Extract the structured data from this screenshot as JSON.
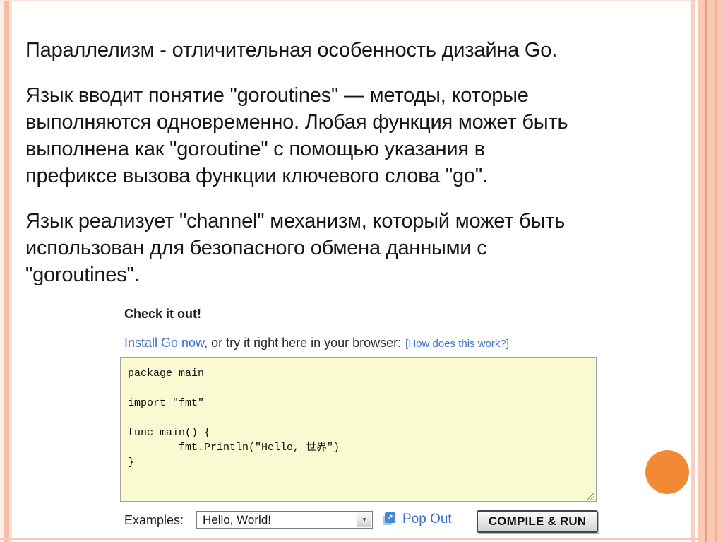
{
  "slide": {
    "paragraph1": "Параллелизм - отличительная особенность дизайна Go.",
    "paragraph2": "Язык вводит понятие \"goroutines\" — методы, которые\nвыполняются одновременно. Любая функция может быть\nвыполнена как \"goroutine\" с помощью указания в\nпрефиксе вызова функции ключевого слова \"go\".",
    "paragraph3": "Язык реализует \"channel\" механизм, который может быть\nиспользован для безопасного обмена данными с\n\"goroutines\"."
  },
  "widget": {
    "heading": "Check it out!",
    "install_line": {
      "link": "Install Go now",
      "rest": ", or try it right here in your browser:",
      "how": "[How does this work?]"
    },
    "code": "package main\n\nimport \"fmt\"\n\nfunc main() {\n        fmt.Println(\"Hello, 世界\")\n}",
    "controls": {
      "examples_label": "Examples:",
      "examples_value": "Hello, World!",
      "popout_label": "Pop Out",
      "compile_label": "COMPILE & RUN"
    }
  },
  "icons": {
    "dropdown_arrow": "▼",
    "popout_arrow": "↗"
  },
  "colors": {
    "accent_orange": "#F18A33",
    "link_blue": "#3B70C6",
    "code_background": "#FAFAD2",
    "stripe_salmon": "#F5BDA7",
    "band_peach": "#F9C9B5"
  }
}
